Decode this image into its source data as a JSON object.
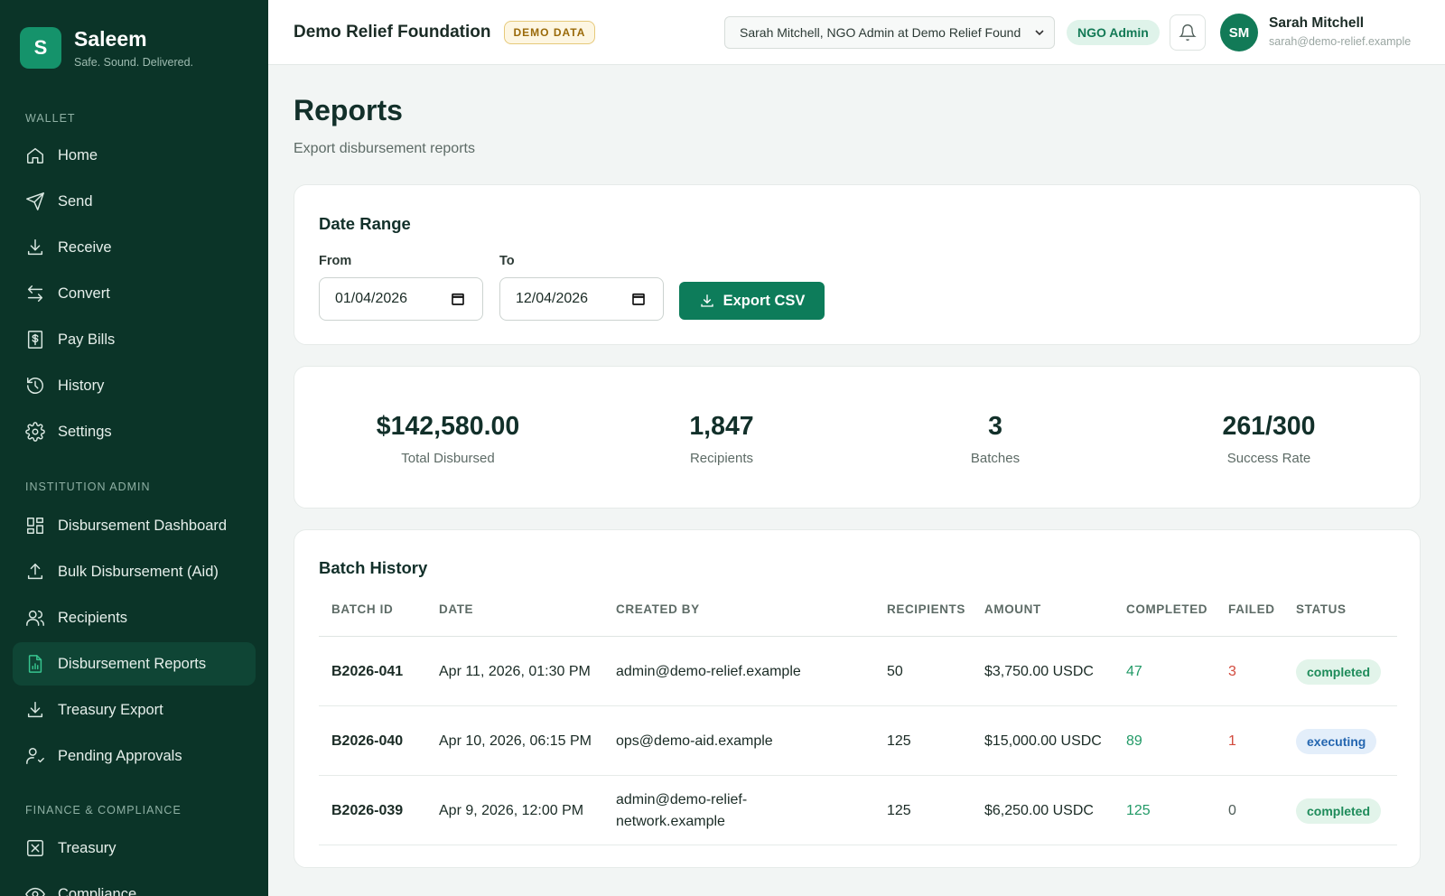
{
  "brand": {
    "initial": "S",
    "name": "Saleem",
    "tagline": "Safe. Sound. Delivered."
  },
  "sidebar": {
    "sections": [
      {
        "label": "WALLET",
        "items": [
          {
            "label": "Home",
            "icon": "home-icon"
          },
          {
            "label": "Send",
            "icon": "send-icon"
          },
          {
            "label": "Receive",
            "icon": "download-icon"
          },
          {
            "label": "Convert",
            "icon": "swap-icon"
          },
          {
            "label": "Pay Bills",
            "icon": "bill-icon"
          },
          {
            "label": "History",
            "icon": "history-icon"
          },
          {
            "label": "Settings",
            "icon": "gear-icon"
          }
        ]
      },
      {
        "label": "INSTITUTION ADMIN",
        "items": [
          {
            "label": "Disbursement Dashboard",
            "icon": "dashboard-icon"
          },
          {
            "label": "Bulk Disbursement (Aid)",
            "icon": "upload-icon"
          },
          {
            "label": "Recipients",
            "icon": "users-icon"
          },
          {
            "label": "Disbursement Reports",
            "icon": "report-icon",
            "active": true
          },
          {
            "label": "Treasury Export",
            "icon": "download-icon"
          },
          {
            "label": "Pending Approvals",
            "icon": "user-check-icon"
          }
        ]
      },
      {
        "label": "FINANCE & COMPLIANCE",
        "items": [
          {
            "label": "Treasury",
            "icon": "treasury-icon"
          },
          {
            "label": "Compliance",
            "icon": "eye-icon"
          }
        ]
      }
    ]
  },
  "topbar": {
    "org_name": "Demo Relief Foundation",
    "demo_badge": "DEMO DATA",
    "user_select_value": "Sarah Mitchell, NGO Admin at Demo Relief Found",
    "role": "NGO Admin",
    "avatar_initials": "SM",
    "user_name": "Sarah Mitchell",
    "user_email": "sarah@demo-relief.example"
  },
  "page": {
    "title": "Reports",
    "subtitle": "Export disbursement reports"
  },
  "date_range": {
    "title": "Date Range",
    "from_label": "From",
    "from_value": "01/04/2026",
    "to_label": "To",
    "to_value": "12/04/2026",
    "export_label": "Export CSV"
  },
  "stats": [
    {
      "value": "$142,580.00",
      "label": "Total Disbursed"
    },
    {
      "value": "1,847",
      "label": "Recipients"
    },
    {
      "value": "3",
      "label": "Batches"
    },
    {
      "value": "261/300",
      "label": "Success Rate"
    }
  ],
  "batch_history": {
    "title": "Batch History",
    "columns": [
      "BATCH ID",
      "DATE",
      "CREATED BY",
      "RECIPIENTS",
      "AMOUNT",
      "COMPLETED",
      "FAILED",
      "STATUS"
    ],
    "rows": [
      {
        "batch_id": "B2026-041",
        "date": "Apr 11, 2026, 01:30 PM",
        "created_by": "admin@demo-relief.example",
        "recipients": "50",
        "amount": "$3,750.00 USDC",
        "completed": "47",
        "failed": "3",
        "status": "completed"
      },
      {
        "batch_id": "B2026-040",
        "date": "Apr 10, 2026, 06:15 PM",
        "created_by": "ops@demo-aid.example",
        "recipients": "125",
        "amount": "$15,000.00 USDC",
        "completed": "89",
        "failed": "1",
        "status": "executing"
      },
      {
        "batch_id": "B2026-039",
        "date": "Apr 9, 2026, 12:00 PM",
        "created_by": "admin@demo-relief-network.example",
        "recipients": "125",
        "amount": "$6,250.00 USDC",
        "completed": "125",
        "failed": "0",
        "status": "completed"
      }
    ]
  },
  "colors": {
    "sidebar_bg": "#0b3428",
    "accent": "#0d7c5a",
    "success": "#229a67",
    "danger": "#d24a3d",
    "info": "#2466b0"
  }
}
